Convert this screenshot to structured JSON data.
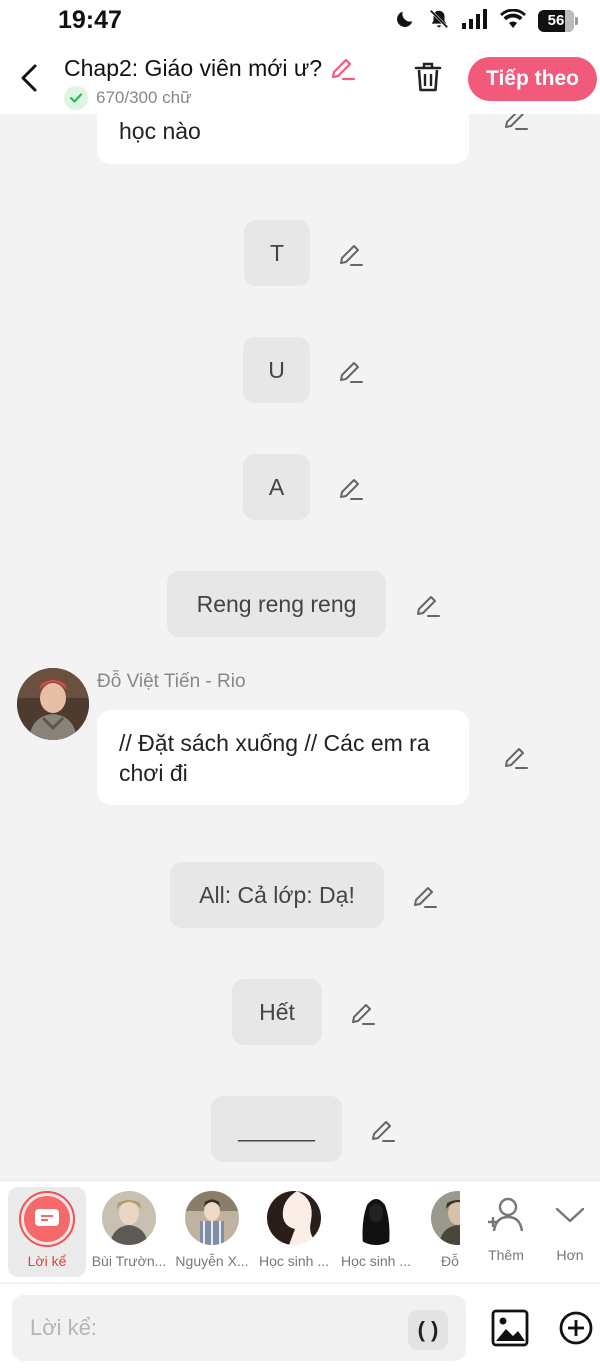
{
  "status_bar": {
    "time": "19:47",
    "battery": "56",
    "icons": [
      "moon-icon",
      "bell-off-icon",
      "signal-icon",
      "wifi-icon",
      "battery-icon"
    ]
  },
  "header": {
    "title": "Chap2: Giáo viên mới ư?",
    "word_count": "670/300 chữ",
    "next_label": "Tiếp theo",
    "accent_color": "#f25a7b"
  },
  "messages": [
    {
      "type": "speech",
      "text": "học nào"
    },
    {
      "type": "narration",
      "text": "T"
    },
    {
      "type": "narration",
      "text": "U"
    },
    {
      "type": "narration",
      "text": "A"
    },
    {
      "type": "narration",
      "text": "Reng reng reng"
    },
    {
      "type": "speech",
      "speaker": "Đỗ Việt Tiến - Rio",
      "text": "// Đặt sách xuống // Các em ra chơi đi"
    },
    {
      "type": "narration",
      "text": "All: Cả lớp: Dạ!"
    },
    {
      "type": "narration",
      "text": "Hết"
    },
    {
      "type": "narration",
      "text": "______"
    }
  ],
  "characters": [
    {
      "label": "Lời kể",
      "active": true
    },
    {
      "label": "Bùi Trườn..."
    },
    {
      "label": "Nguyễn X..."
    },
    {
      "label": "Học sinh ..."
    },
    {
      "label": "Học sinh ..."
    },
    {
      "label": "Đỗ Vi"
    }
  ],
  "side_actions": {
    "add_label": "Thêm",
    "more_label": "Hơn"
  },
  "input": {
    "placeholder": "Lời kể:",
    "paren_label": "( )"
  }
}
